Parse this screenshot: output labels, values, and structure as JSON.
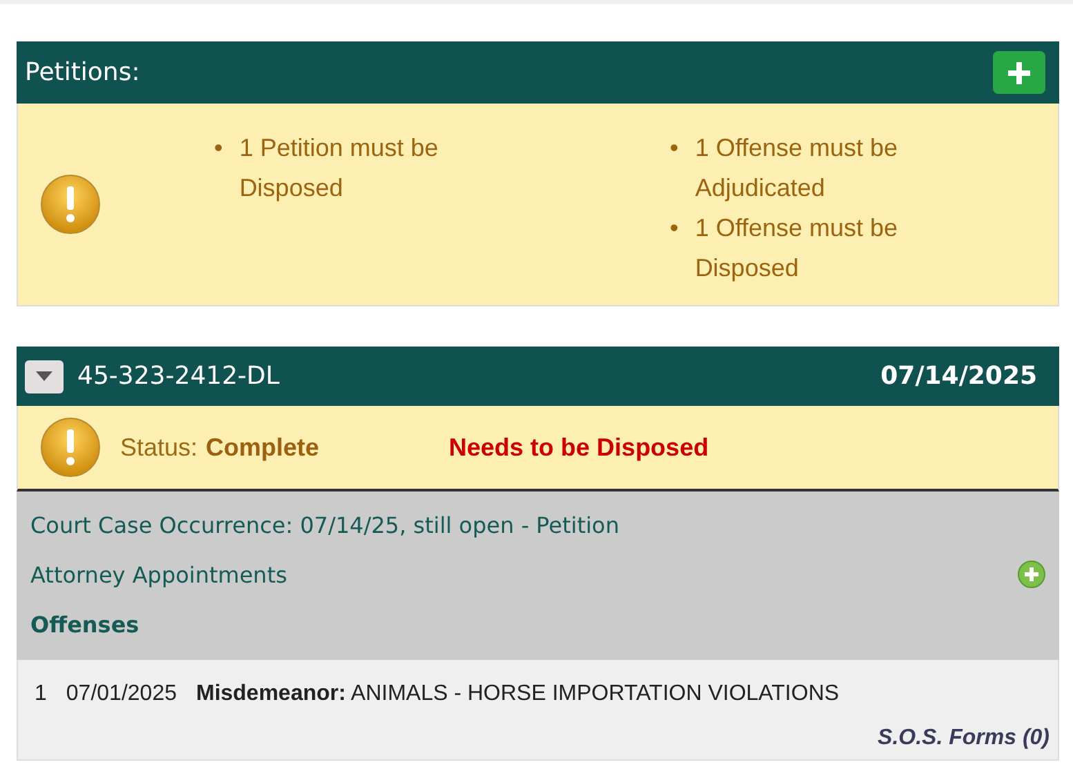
{
  "petitions": {
    "title": "Petitions:",
    "warning_columns": [
      [
        {
          "bullet": "•",
          "text": "1 Petition must be Disposed"
        }
      ],
      [
        {
          "bullet": "•",
          "text": "1 Offense must be Adjudicated"
        },
        {
          "bullet": "•",
          "text": "1 Offense must be Disposed"
        }
      ]
    ]
  },
  "case": {
    "number": "45-323-2412-DL",
    "date": "07/14/2025",
    "status_label": "Status:",
    "status_value": "Complete",
    "alert": "Needs to be Disposed",
    "occurrence": "Court Case Occurrence: 07/14/25, still open - Petition",
    "attorney_label": "Attorney Appointments",
    "offenses_label": "Offenses",
    "offenses": [
      {
        "index": "1",
        "date": "07/01/2025",
        "description": "**Misdemeanor:** ANIMALS - HORSE IMPORTATION VIOLATIONS"
      }
    ],
    "sos_link": "S.O.S. Forms (0)"
  }
}
